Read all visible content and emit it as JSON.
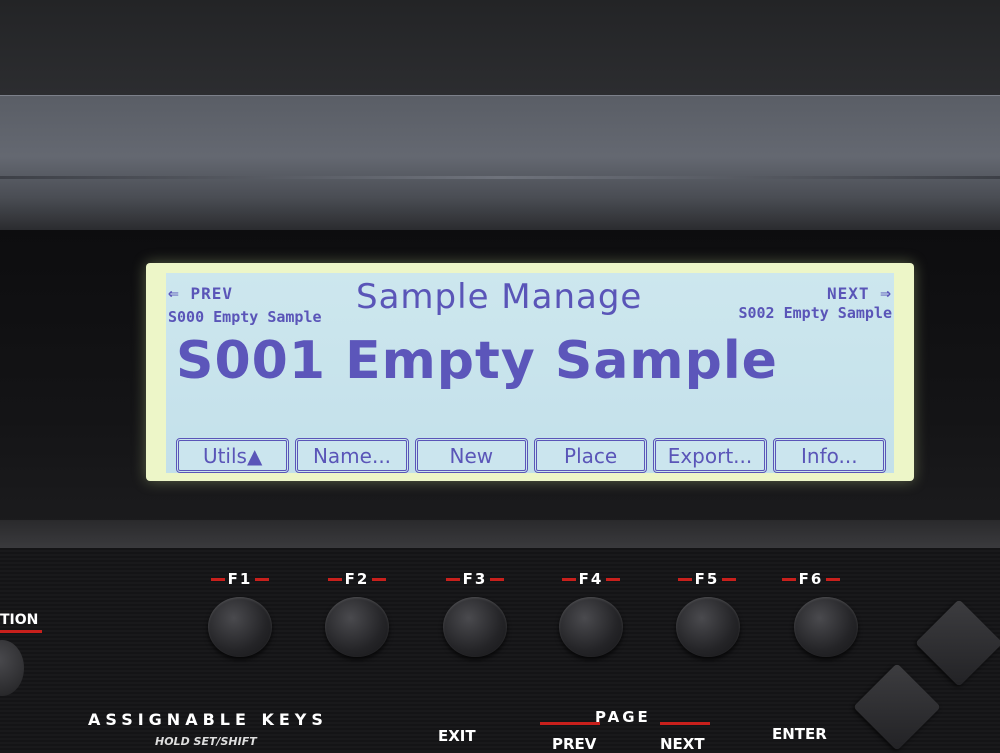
{
  "lcd": {
    "title": "Sample Manage",
    "nav_prev_label": "PREV",
    "nav_next_label": "NEXT",
    "prev_sample": "S000 Empty Sample",
    "next_sample": "S002 Empty Sample",
    "current_sample": "S001 Empty Sample",
    "softkeys": [
      "Utils▲",
      "Name...",
      "New",
      "Place",
      "Export...",
      "Info..."
    ]
  },
  "panel": {
    "function_keys": [
      "F1",
      "F2",
      "F3",
      "F4",
      "F5",
      "F6"
    ],
    "side_label": "TION",
    "assignable_keys": "ASSIGNABLE KEYS",
    "hold_set_shift": "HOLD SET/SHIFT",
    "exit": "EXIT",
    "page": "PAGE",
    "prev": "PREV",
    "next": "NEXT",
    "enter": "ENTER"
  },
  "colors": {
    "lcd_text": "#5a55b8",
    "lcd_background": "#c3e0ea",
    "lcd_backlight": "#edf6c8",
    "accent_red": "#c8201c"
  }
}
